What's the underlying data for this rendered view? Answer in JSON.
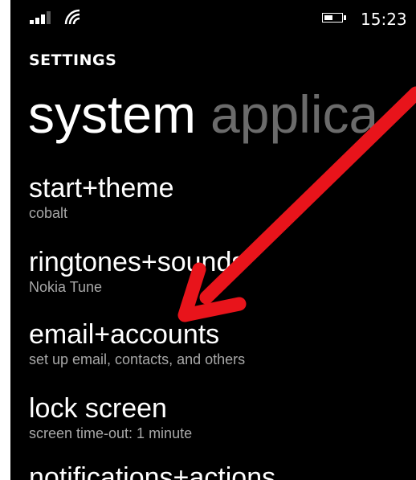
{
  "status_bar": {
    "signal_icon": "signal-bars-icon",
    "wifi_icon": "wifi-icon",
    "battery_icon": "battery-icon",
    "time": "15:23"
  },
  "header": {
    "app_label": "SETTINGS"
  },
  "pivot": {
    "active": "system",
    "next": "applica"
  },
  "settings_items": [
    {
      "title": "start+theme",
      "subtitle": "cobalt"
    },
    {
      "title": "ringtones+sounds",
      "subtitle": "Nokia Tune"
    },
    {
      "title": "email+accounts",
      "subtitle": "set up email, contacts, and others"
    },
    {
      "title": "lock screen",
      "subtitle": "screen time-out: 1 minute"
    },
    {
      "title": "notifications+actions",
      "subtitle": ""
    }
  ],
  "annotation": {
    "arrow_color": "#e8141b",
    "points_to": "email+accounts"
  },
  "colors": {
    "background": "#000000",
    "text": "#ffffff",
    "inactive_pivot": "#6b6b6b",
    "subtitle": "#a8a8a8"
  }
}
